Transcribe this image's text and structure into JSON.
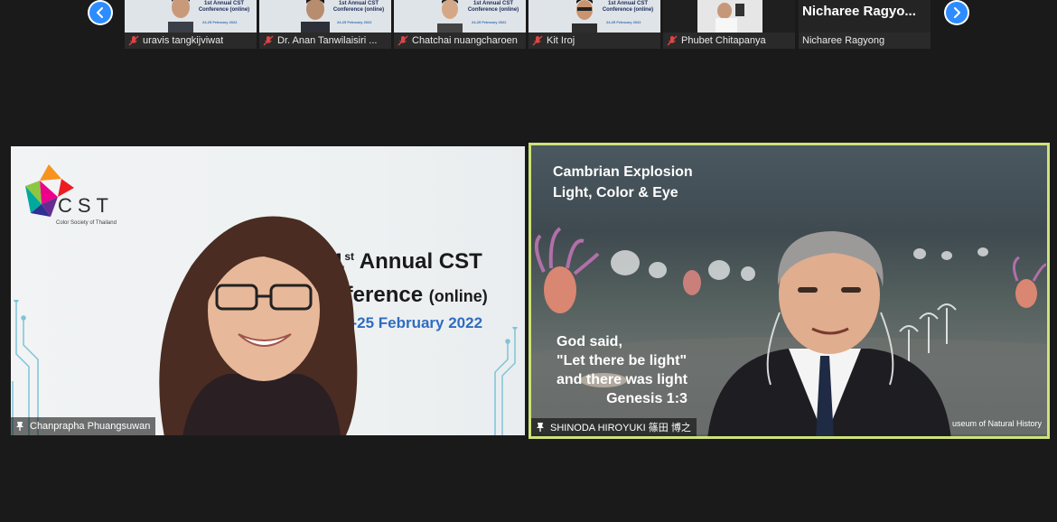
{
  "navigation": {
    "prev_label": "Previous page",
    "next_label": "Next page"
  },
  "thumbnails": [
    {
      "name": "uravis tangkijviwat",
      "muted": true,
      "slide_line1": "1st Annual CST",
      "slide_line2": "Conference (online)",
      "slide_date": "24-25 February 2022"
    },
    {
      "name": "Dr. Anan Tanwilaisiri ...",
      "muted": true,
      "slide_line1": "1st Annual CST",
      "slide_line2": "Conference (online)",
      "slide_date": "24-25 February 2022"
    },
    {
      "name": "Chatchai nuangcharoen",
      "muted": true,
      "slide_line1": "1st Annual CST",
      "slide_line2": "Conference (online)",
      "slide_date": "24-25 February 2022"
    },
    {
      "name": "Kit Iroj",
      "muted": true,
      "slide_line1": "1st Annual CST",
      "slide_line2": "Conference (online)",
      "slide_date": "24-25 February 2022"
    },
    {
      "name": "Phubet Chitapanya",
      "muted": true
    },
    {
      "name": "Nicharee Ragyong",
      "big_name": "Nicharee  Ragyo...",
      "muted": false
    }
  ],
  "left_tile": {
    "participant": "Chanprapha Phuangsuwan",
    "logo_text": "CST",
    "logo_sub": "Color Society of Thailand",
    "title_prefix": "1",
    "title_sup": "st",
    "title_rest": " Annual CST",
    "subtitle_main": "nference ",
    "subtitle_small": "(online)",
    "date": "4-25 February 2022"
  },
  "right_tile": {
    "participant": "SHINODA HIROYUKI 篠田 博之",
    "title_line1": "Cambrian Explosion",
    "title_line2": "Light, Color & Eye",
    "verse_line1": "God said,",
    "verse_line2": "\"Let there be light\"",
    "verse_line3": "and there was light",
    "verse_ref": "Genesis 1:3",
    "museum": "useum of Natural History",
    "active_speaker_color": "#cde27a"
  },
  "colors": {
    "background": "#1a1a1a",
    "accent_blue": "#2d8cff",
    "muted_red": "#e04545"
  }
}
